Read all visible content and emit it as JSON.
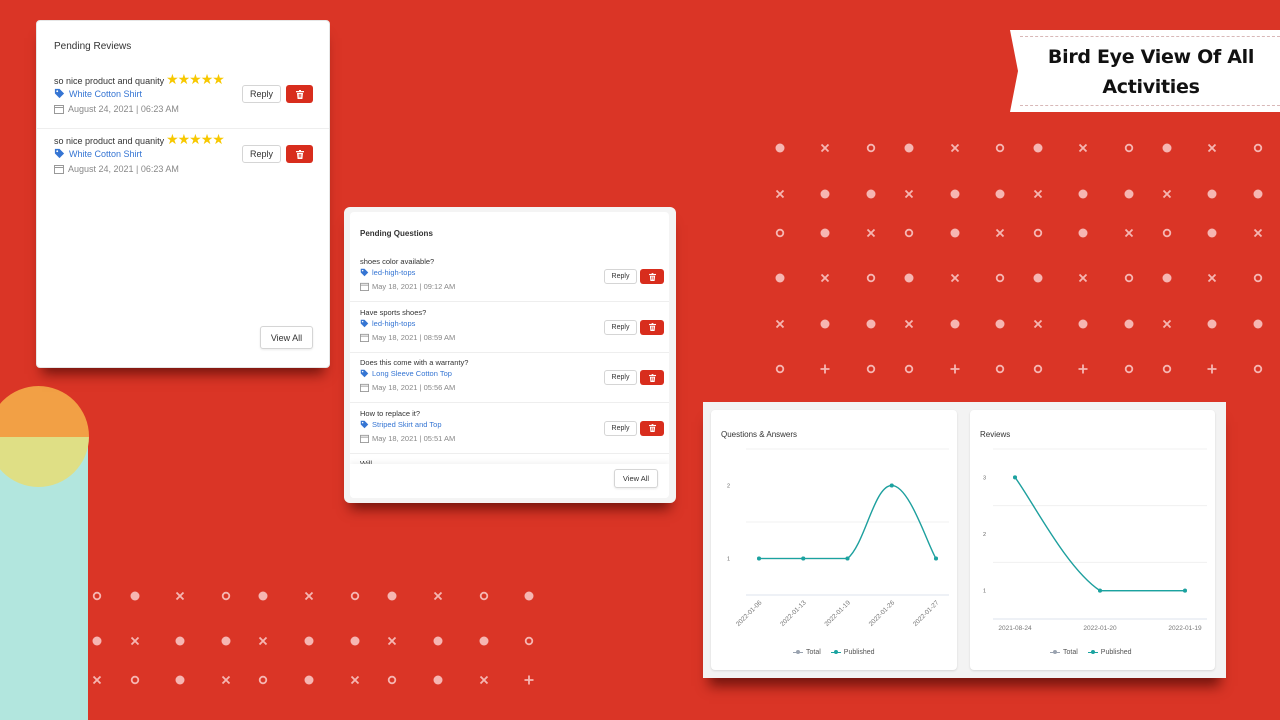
{
  "banner": {
    "title_line1": "Bird Eye View Of All",
    "title_line2": "Activities"
  },
  "reviews": {
    "title": "Pending Reviews",
    "items": [
      {
        "text": "so nice product and quanity",
        "rating": 5,
        "stars": "★★★★★",
        "product": "White Cotton Shirt",
        "date": "August 24, 2021 | 06:23 AM"
      },
      {
        "text": "so nice product and quanity",
        "rating": 5,
        "stars": "★★★★★",
        "product": "White Cotton Shirt",
        "date": "August 24, 2021 | 06:23 AM"
      }
    ],
    "reply_label": "Reply",
    "view_all_label": "View All"
  },
  "questions": {
    "title": "Pending Questions",
    "items": [
      {
        "text": "shoes color available?",
        "product": "led-high-tops",
        "date": "May 18, 2021 | 09:12 AM"
      },
      {
        "text": "Have sports shoes?",
        "product": "led-high-tops",
        "date": "May 18, 2021 | 08:59 AM"
      },
      {
        "text": "Does this come with a warranty?",
        "product": "Long Sleeve Cotton Top",
        "date": "May 18, 2021 | 05:56 AM"
      },
      {
        "text": "How to replace it?",
        "product": "Striped Skirt and Top",
        "date": "May 18, 2021 | 05:51 AM"
      },
      {
        "text": "Will...",
        "product": "",
        "date": ""
      }
    ],
    "reply_label": "Reply",
    "view_all_label": "View All"
  },
  "icons": {
    "tag": "tag-icon",
    "calendar": "calendar-icon",
    "trash": "trash-icon"
  },
  "colors": {
    "background": "#da3526",
    "accent_red": "#d82d1d",
    "link_blue": "#3575d3",
    "star_yellow": "#f7c800",
    "series_published": "#1aa3a0",
    "series_total": "#9aa3b0",
    "mint": "#b2e6de",
    "orange": "#f2a045",
    "yellow": "#dfdf85"
  },
  "chart_data": [
    {
      "type": "line",
      "title": "Questions & Answers",
      "categories": [
        "2022-01-06",
        "2022-01-13",
        "2022-01-19",
        "2022-01-26",
        "2022-01-27"
      ],
      "series": [
        {
          "name": "Total",
          "values": [
            1,
            1,
            1,
            2,
            1
          ]
        },
        {
          "name": "Published",
          "values": [
            1,
            1,
            1,
            2,
            1
          ]
        }
      ],
      "yticks": [
        1,
        2
      ],
      "ylim": [
        0.5,
        2.5
      ],
      "xlabel": "",
      "ylabel": "",
      "grid": true,
      "legend": "bottom",
      "rotated_xlabels": true
    },
    {
      "type": "line",
      "title": "Reviews",
      "categories": [
        "2021-08-24",
        "2022-01-20",
        "2022-01-19"
      ],
      "series": [
        {
          "name": "Total",
          "values": [
            3,
            1,
            1
          ]
        },
        {
          "name": "Published",
          "values": [
            3,
            1,
            1
          ]
        }
      ],
      "yticks": [
        1,
        2,
        3
      ],
      "ylim": [
        0.5,
        3.5
      ],
      "xlabel": "",
      "ylabel": "",
      "grid": true,
      "legend": "bottom",
      "rotated_xlabels": false
    }
  ]
}
